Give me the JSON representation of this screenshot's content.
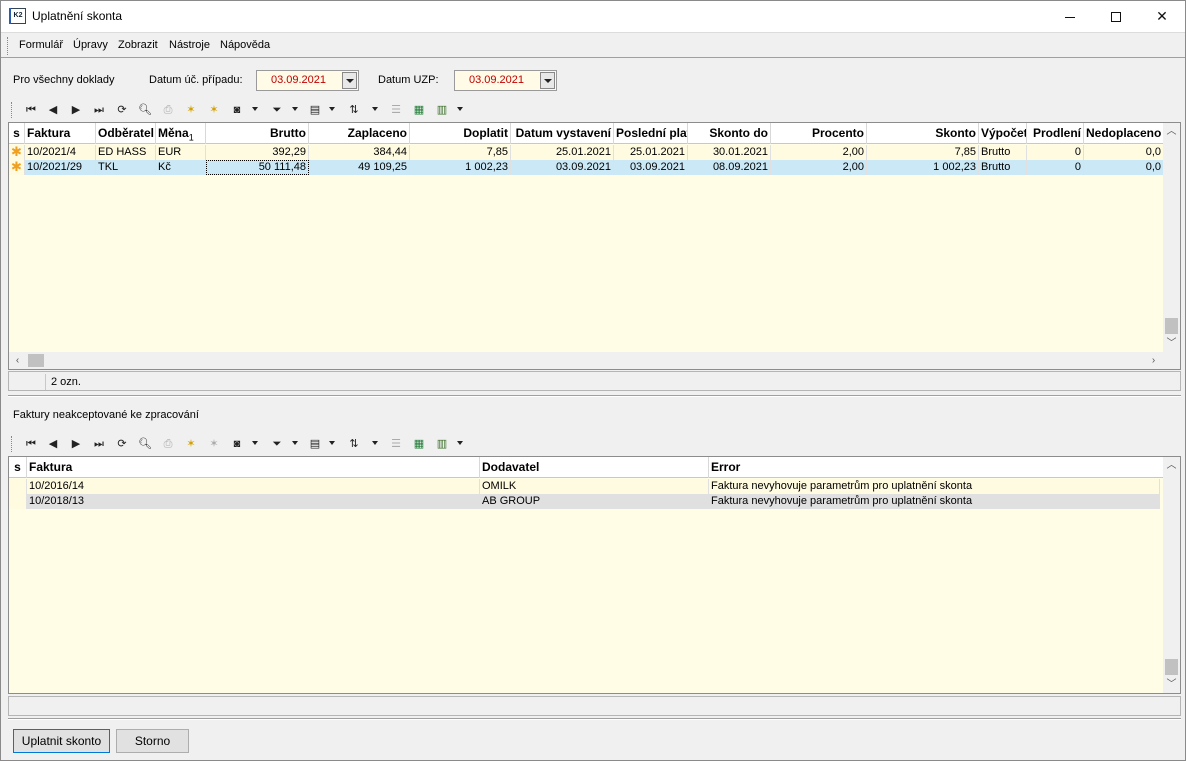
{
  "window": {
    "title": "Uplatnění skonta",
    "app_icon_text": "K2"
  },
  "menu": {
    "items": [
      "Formulář",
      "Úpravy",
      "Zobrazit",
      "Nástroje",
      "Nápověda"
    ]
  },
  "filter": {
    "scope_label": "Pro všechny doklady",
    "date_event_label": "Datum úč. případu:",
    "date_event_value": "03.09.2021",
    "date_uzp_label": "Datum UZP:",
    "date_uzp_value": "03.09.2021"
  },
  "toolbar_icons": [
    "first-record-icon",
    "previous-record-icon",
    "next-record-icon",
    "last-record-icon",
    "refresh-icon",
    "find-icon",
    "print-icon",
    "add-star-icon",
    "edit-star-icon",
    "camera-icon",
    "filter-icon",
    "columns-icon",
    "sort-icon",
    "list-icon",
    "excel-export-icon",
    "calculator-icon"
  ],
  "top_grid": {
    "columns": [
      "s",
      "Faktura",
      "Odběratel",
      "Měna",
      "Brutto",
      "Zaplaceno",
      "Doplatit",
      "Datum vystavení",
      "Poslední platba",
      "Skonto do",
      "Procento",
      "Skonto",
      "Výpočet",
      "Prodlení",
      "Nedoplaceno"
    ],
    "sort_indicator": "1",
    "rows": [
      {
        "marker": "✱",
        "faktura": "10/2021/4",
        "odberatel": "ED HASS",
        "mena": "EUR",
        "brutto": "392,29",
        "zaplaceno": "384,44",
        "doplatit": "7,85",
        "vystaveni": "25.01.2021",
        "platba": "25.01.2021",
        "skonto_do": "30.01.2021",
        "procento": "2,00",
        "skonto": "7,85",
        "vypocet": "Brutto",
        "prodleni": "0",
        "nedoplaceno": "0,0"
      },
      {
        "marker": "✱",
        "faktura": "10/2021/29",
        "odberatel": "TKL",
        "mena": "Kč",
        "brutto": "50 111,48",
        "zaplaceno": "49 109,25",
        "doplatit": "1 002,23",
        "vystaveni": "03.09.2021",
        "platba": "03.09.2021",
        "skonto_do": "08.09.2021",
        "procento": "2,00",
        "skonto": "1 002,23",
        "vypocet": "Brutto",
        "prodleni": "0",
        "nedoplaceno": "0,0"
      }
    ],
    "status": "2 ozn."
  },
  "bottom_section": {
    "label": "Faktury neakceptované ke zpracování"
  },
  "bottom_grid": {
    "columns": [
      "s",
      "Faktura",
      "Dodavatel",
      "Error"
    ],
    "rows": [
      {
        "faktura": "10/2016/14",
        "dodavatel": "OMILK",
        "error": "Faktura nevyhovuje parametrům pro uplatnění skonta"
      },
      {
        "faktura": "10/2018/13",
        "dodavatel": "AB GROUP",
        "error": "Faktura nevyhovuje parametrům pro uplatnění skonta"
      }
    ]
  },
  "buttons": {
    "apply": "Uplatnit skonto",
    "cancel": "Storno"
  }
}
